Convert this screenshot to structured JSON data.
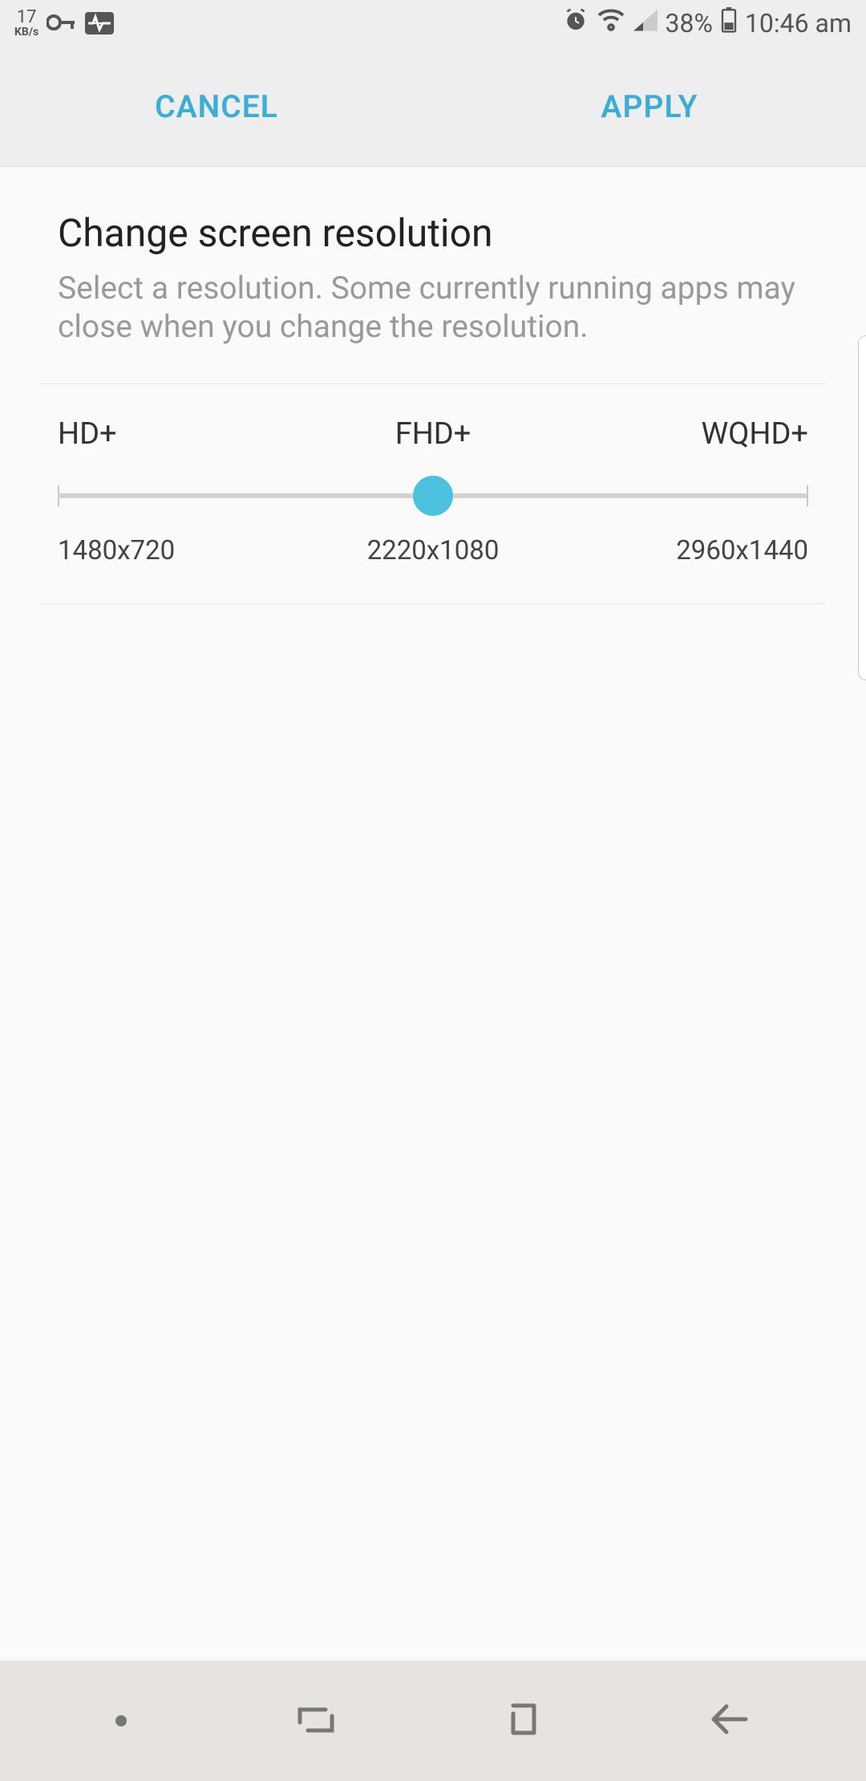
{
  "statusbar": {
    "speed_value": "17",
    "speed_unit": "KB/s",
    "battery_pct": "38%",
    "time": "10:46 am"
  },
  "actions": {
    "cancel": "CANCEL",
    "apply": "APPLY"
  },
  "header": {
    "title": "Change screen resolution",
    "description": "Select a resolution. Some currently running apps may close when you change the resolution."
  },
  "slider": {
    "options": [
      {
        "label": "HD+",
        "resolution": "1480x720"
      },
      {
        "label": "FHD+",
        "resolution": "2220x1080"
      },
      {
        "label": "WQHD+",
        "resolution": "2960x1440"
      }
    ],
    "selected_index": 1
  },
  "colors": {
    "accent": "#3caed6",
    "thumb": "#4dc1e0"
  }
}
